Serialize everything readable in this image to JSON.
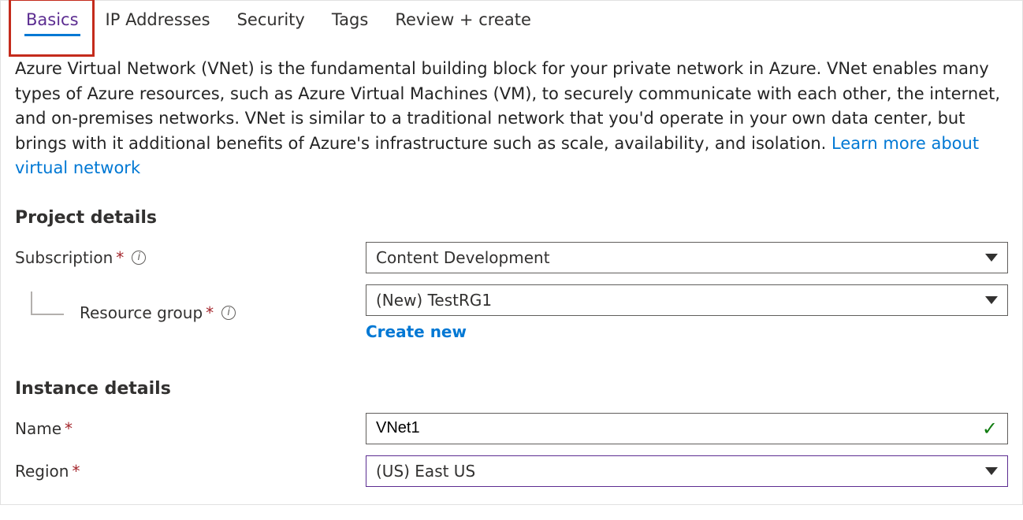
{
  "tabs": [
    {
      "label": "Basics",
      "active": true
    },
    {
      "label": "IP Addresses",
      "active": false
    },
    {
      "label": "Security",
      "active": false
    },
    {
      "label": "Tags",
      "active": false
    },
    {
      "label": "Review + create",
      "active": false
    }
  ],
  "intro": {
    "text": "Azure Virtual Network (VNet) is the fundamental building block for your private network in Azure. VNet enables many types of Azure resources, such as Azure Virtual Machines (VM), to securely communicate with each other, the internet, and on-premises networks. VNet is similar to a traditional network that you'd operate in your own data center, but brings with it additional benefits of Azure's infrastructure such as scale, availability, and isolation.  ",
    "learn_more_label": "Learn more about virtual network"
  },
  "sections": {
    "project": {
      "title": "Project details",
      "subscription": {
        "label": "Subscription",
        "value": "Content Development"
      },
      "resource_group": {
        "label": "Resource group",
        "value": "(New) TestRG1",
        "create_new_label": "Create new"
      }
    },
    "instance": {
      "title": "Instance details",
      "name": {
        "label": "Name",
        "value": "VNet1"
      },
      "region": {
        "label": "Region",
        "value": "(US) East US"
      }
    }
  },
  "glyphs": {
    "required": "*",
    "info": "i",
    "check": "✓"
  }
}
